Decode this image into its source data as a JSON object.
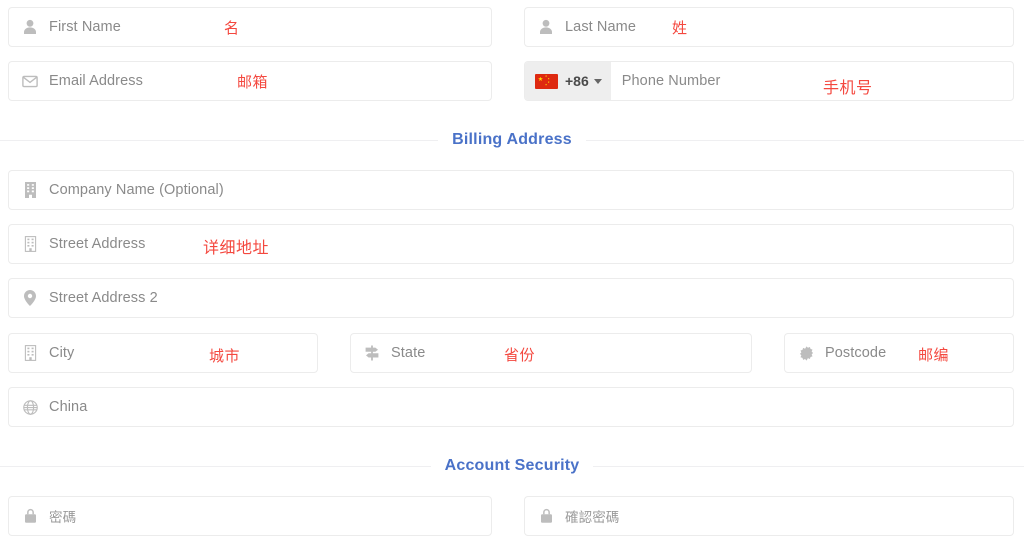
{
  "form": {
    "fields": {
      "first_name": {
        "placeholder": "First Name",
        "icon": "user-icon",
        "annotation": "名"
      },
      "last_name": {
        "placeholder": "Last Name",
        "icon": "user-icon",
        "annotation": "姓"
      },
      "email": {
        "placeholder": "Email Address",
        "icon": "envelope-icon",
        "annotation": "邮箱"
      },
      "phone": {
        "placeholder": "Phone Number",
        "icon": "flag-cn-icon",
        "dial_code": "+86",
        "annotation": "手机号"
      },
      "company": {
        "placeholder": "Company Name (Optional)",
        "icon": "building-icon",
        "annotation": ""
      },
      "street_address": {
        "placeholder": "Street Address",
        "icon": "building-icon",
        "annotation": "详细地址"
      },
      "street_address_2": {
        "placeholder": "Street Address 2",
        "icon": "map-marker-icon",
        "annotation": ""
      },
      "city": {
        "placeholder": "City",
        "icon": "building-icon",
        "annotation": "城市"
      },
      "state": {
        "placeholder": "State",
        "icon": "map-signs-icon",
        "annotation": "省份"
      },
      "postcode": {
        "placeholder": "Postcode",
        "icon": "certificate-icon",
        "annotation": "邮编"
      },
      "country": {
        "value": "China",
        "icon": "globe-icon",
        "annotation": ""
      },
      "password": {
        "placeholder": "密碼",
        "icon": "lock-icon",
        "annotation": ""
      },
      "confirm_password": {
        "placeholder": "確認密碼",
        "icon": "lock-icon",
        "annotation": ""
      }
    },
    "sections": {
      "billing_address": "Billing Address",
      "account_security": "Account Security"
    }
  },
  "colors": {
    "accent_heading": "#4a72c8",
    "annotation_red": "#f4483f",
    "field_border": "#ececec",
    "placeholder_text": "#8a8a8a",
    "icon_gray": "#bdbdbd",
    "prefix_bg": "#eeeeee",
    "flag_red": "#de2910",
    "flag_yellow": "#ffde00"
  }
}
